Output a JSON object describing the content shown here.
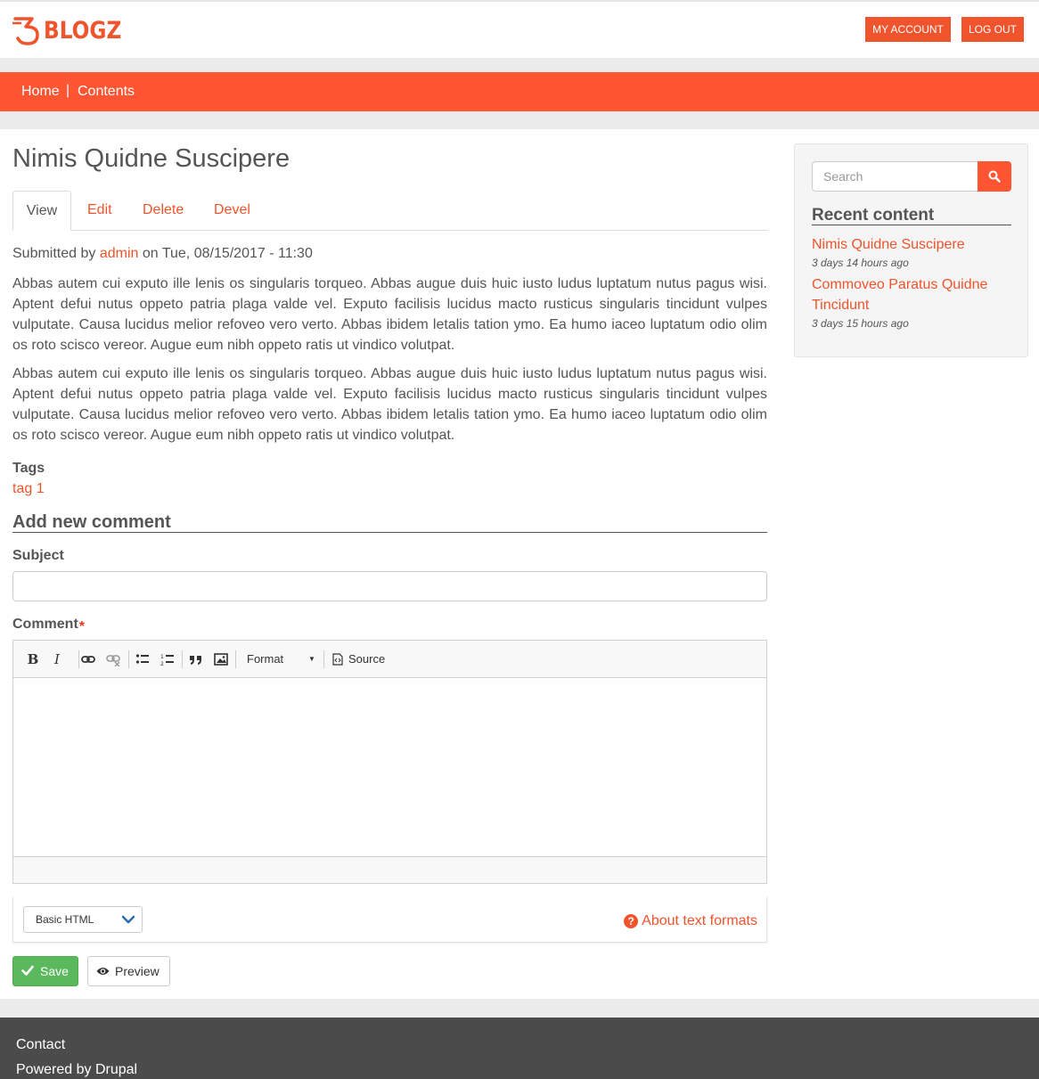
{
  "header": {
    "logo_text": "BLOGZ",
    "my_account_label": "MY ACCOUNT",
    "logout_label": "LOG OUT"
  },
  "nav": {
    "home": "Home",
    "separator": "|",
    "contents": "Contents"
  },
  "article": {
    "title": "Nimis Quidne Suscipere",
    "tabs": [
      "View",
      "Edit",
      "Delete",
      "Devel"
    ],
    "submitted_prefix": "Submitted by",
    "author": "admin",
    "submitted_suffix": "on Tue, 08/15/2017 - 11:30",
    "paragraphs": [
      "Abbas autem cui exputo ille lenis os singularis torqueo. Abbas augue duis huic iusto ludus luptatum nutus pagus wisi. Aptent defui nutus oppeto patria plaga valde vel. Exputo facilisis lucidus macto rusticus singularis tincidunt vulpes vulputate. Causa lucidus melior refoveo vero verto. Abbas ibidem letalis tation ymo. Ea humo iaceo luptatum odio olim os roto scisco vereor. Augue eum nibh oppeto ratis ut vindico volutpat.",
      "Abbas autem cui exputo ille lenis os singularis torqueo. Abbas augue duis huic iusto ludus luptatum nutus pagus wisi. Aptent defui nutus oppeto patria plaga valde vel. Exputo facilisis lucidus macto rusticus singularis tincidunt vulpes vulputate. Causa lucidus melior refoveo vero verto. Abbas ibidem letalis tation ymo. Ea humo iaceo luptatum odio olim os roto scisco vereor. Augue eum nibh oppeto ratis ut vindico volutpat."
    ],
    "tags_label": "Tags",
    "tags": [
      "tag 1"
    ]
  },
  "comment_form": {
    "heading": "Add new comment",
    "subject_label": "Subject",
    "subject_value": "",
    "comment_label": "Comment",
    "required_marker": "*",
    "toolbar": {
      "bold": "B",
      "italic": "I",
      "format": "Format",
      "source": "Source"
    },
    "text_format_value": "Basic HTML",
    "about_formats": "About text formats",
    "save_label": "Save",
    "preview_label": "Preview"
  },
  "sidebar": {
    "search_placeholder": "Search",
    "recent_heading": "Recent content",
    "recent": [
      {
        "title": "Nimis Quidne Suscipere",
        "time": "3 days 14 hours ago"
      },
      {
        "title": "Commoveo Paratus Quidne Tincidunt",
        "time": "3 days 15 hours ago"
      }
    ]
  },
  "footer": {
    "links": [
      "Contact",
      "Powered by Drupal"
    ]
  },
  "colors": {
    "accent": "#ff5533",
    "link": "#f0542c",
    "save_green": "#5cb85c",
    "footer_bg": "#4b4b4b"
  }
}
